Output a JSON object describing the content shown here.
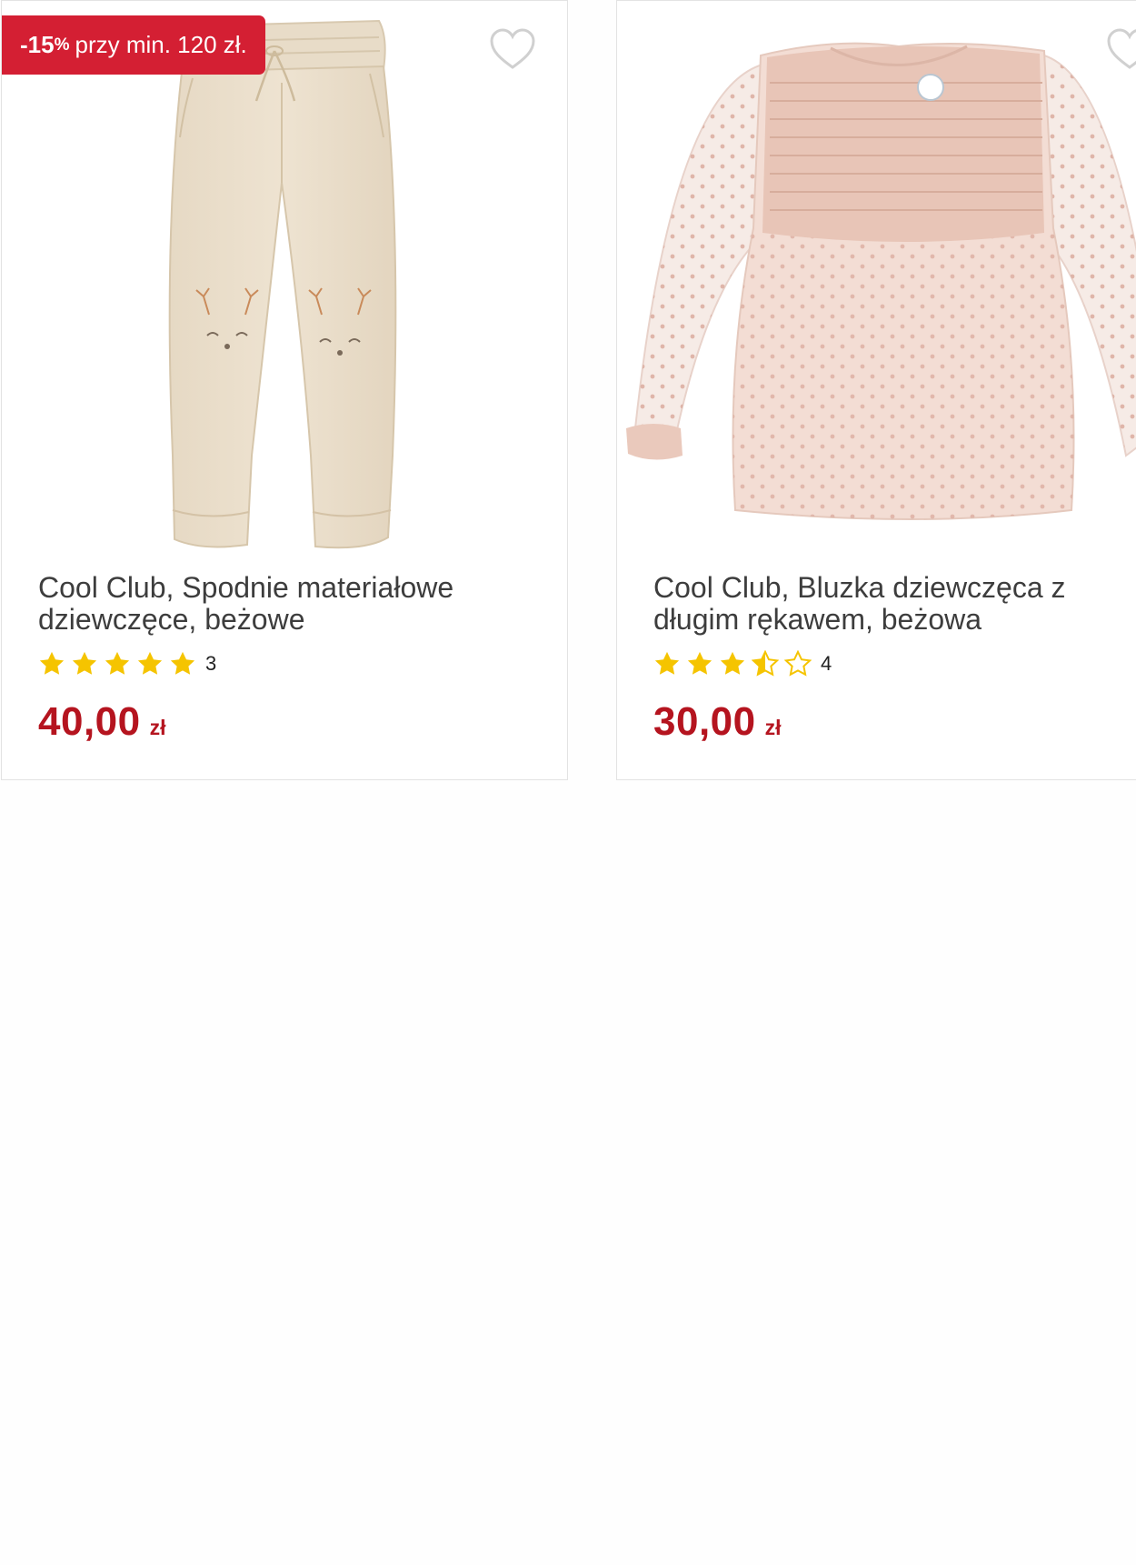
{
  "products": [
    {
      "promo": {
        "discount": "-15",
        "percent_sign": "%",
        "text": "przy min. 120 zł."
      },
      "title": "Cool Club, Spodnie materiałowe dziewczęce, beżowe",
      "rating": 5,
      "review_count": "3",
      "price_amount": "40,00",
      "price_currency": "zł",
      "image_icon": "beige-pants-image"
    },
    {
      "title": "Cool Club, Bluzka dziewczęca z długim rękawem, beżowa",
      "rating": 3.5,
      "review_count": "4",
      "price_amount": "30,00",
      "price_currency": "zł",
      "image_icon": "pink-blouse-image"
    }
  ],
  "colors": {
    "accent": "#d41f33",
    "price": "#b5141f",
    "star": "#f5c400"
  },
  "icons": {
    "favorite": "heart-outline-icon",
    "star_full": "star-icon",
    "star_half": "star-half-icon",
    "star_empty": "star-outline-icon"
  }
}
